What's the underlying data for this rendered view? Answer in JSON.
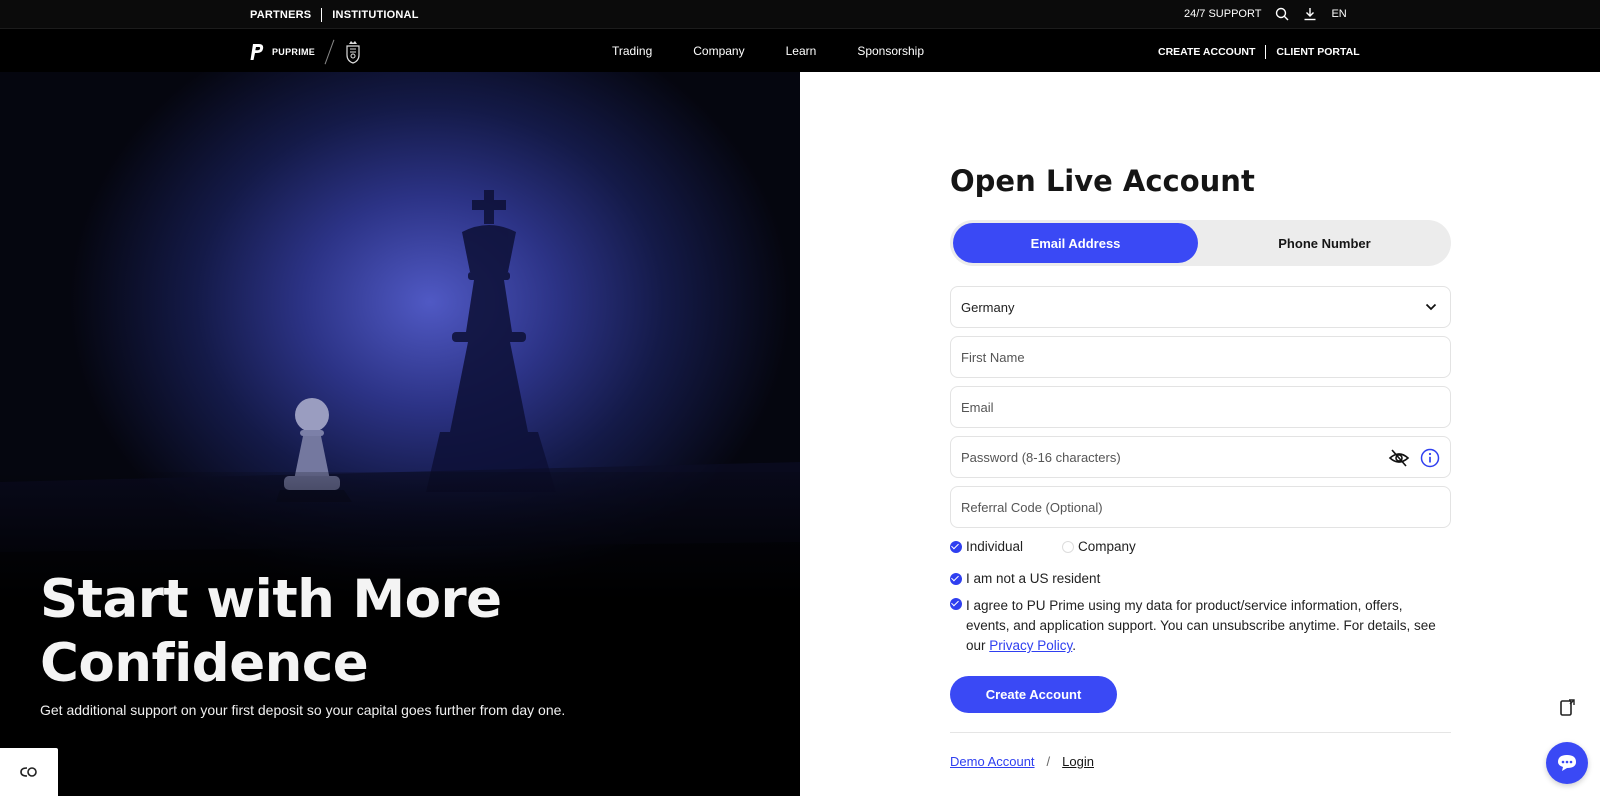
{
  "topbar": {
    "partners": "PARTNERS",
    "institutional": "INSTITUTIONAL",
    "support": "24/7 SUPPORT",
    "language": "EN",
    "icons": [
      "search-icon",
      "download-icon"
    ]
  },
  "nav": {
    "logo_text": "PUPRIME",
    "menu": [
      "Trading",
      "Company",
      "Learn",
      "Sponsorship"
    ],
    "create_account": "CREATE ACCOUNT",
    "client_portal": "CLIENT PORTAL"
  },
  "hero": {
    "headline": "Start with More Confidence",
    "subtext": "Get additional support on your first deposit so your capital goes further from day one."
  },
  "form": {
    "title": "Open Live Account",
    "tabs": [
      {
        "label": "Email Address",
        "active": true
      },
      {
        "label": "Phone Number",
        "active": false
      }
    ],
    "country": "Germany",
    "first_name_placeholder": "First Name",
    "email_placeholder": "Email",
    "password_placeholder": "Password (8-16 characters)",
    "referral_placeholder": "Referral Code (Optional)",
    "account_type": {
      "individual": "Individual",
      "company": "Company",
      "selected": "Individual"
    },
    "us_resident": "I am not a US resident",
    "consent_text": "I agree to PU Prime using my data for product/service information, offers, events, and application support. You can unsubscribe anytime. For details, see our ",
    "privacy_link": "Privacy Policy",
    "consent_end": ".",
    "submit": "Create Account",
    "demo_link": "Demo Account",
    "separator": "/",
    "login_link": "Login"
  },
  "colors": {
    "accent": "#3a49f5",
    "topbar_bg": "#0b0b0b",
    "nav_bg": "#000000"
  }
}
